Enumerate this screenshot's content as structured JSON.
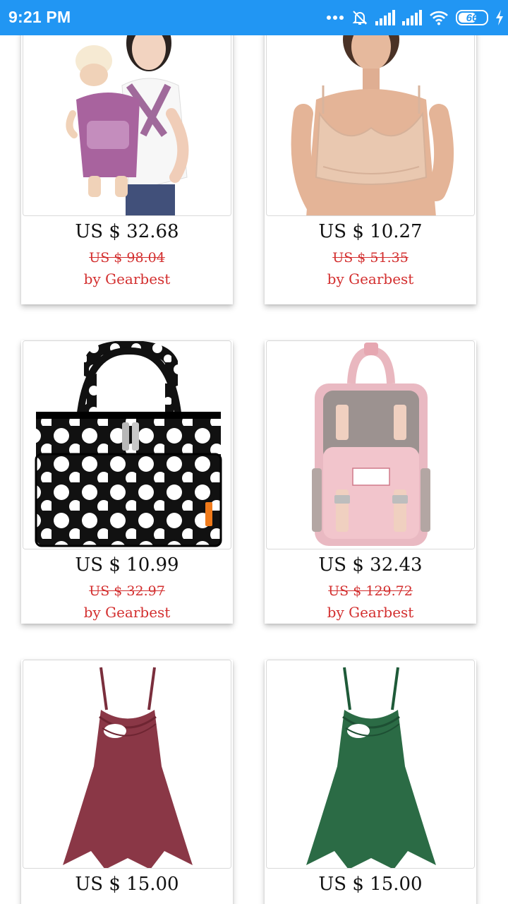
{
  "status_bar": {
    "time": "9:21 PM",
    "battery_level": "66",
    "battery_fraction": 0.66,
    "icons": [
      "more-dots-icon",
      "alarm-off-icon",
      "signal-icon",
      "signal-icon",
      "wifi-icon",
      "battery-icon",
      "charging-bolt-icon"
    ]
  },
  "colors": {
    "status_bar": "#2196f3",
    "price_red": "#d32f2f"
  },
  "products": [
    {
      "image_icon": "baby-carrier-product-image",
      "price": "US $ 32.68",
      "old_price": "US $ 98.04",
      "seller": "by Gearbest"
    },
    {
      "image_icon": "nursing-bra-product-image",
      "price": "US $ 10.27",
      "old_price": "US $ 51.35",
      "seller": "by Gearbest"
    },
    {
      "image_icon": "polka-dot-bag-product-image",
      "price": "US $ 10.99",
      "old_price": "US $ 32.97",
      "seller": "by Gearbest"
    },
    {
      "image_icon": "pink-backpack-product-image",
      "price": "US $ 32.43",
      "old_price": "US $ 129.72",
      "seller": "by Gearbest"
    },
    {
      "image_icon": "maroon-nursing-top-product-image",
      "price": "US $ 15.00",
      "old_price": "",
      "seller": ""
    },
    {
      "image_icon": "green-nursing-top-product-image",
      "price": "US $ 15.00",
      "old_price": "",
      "seller": ""
    }
  ]
}
